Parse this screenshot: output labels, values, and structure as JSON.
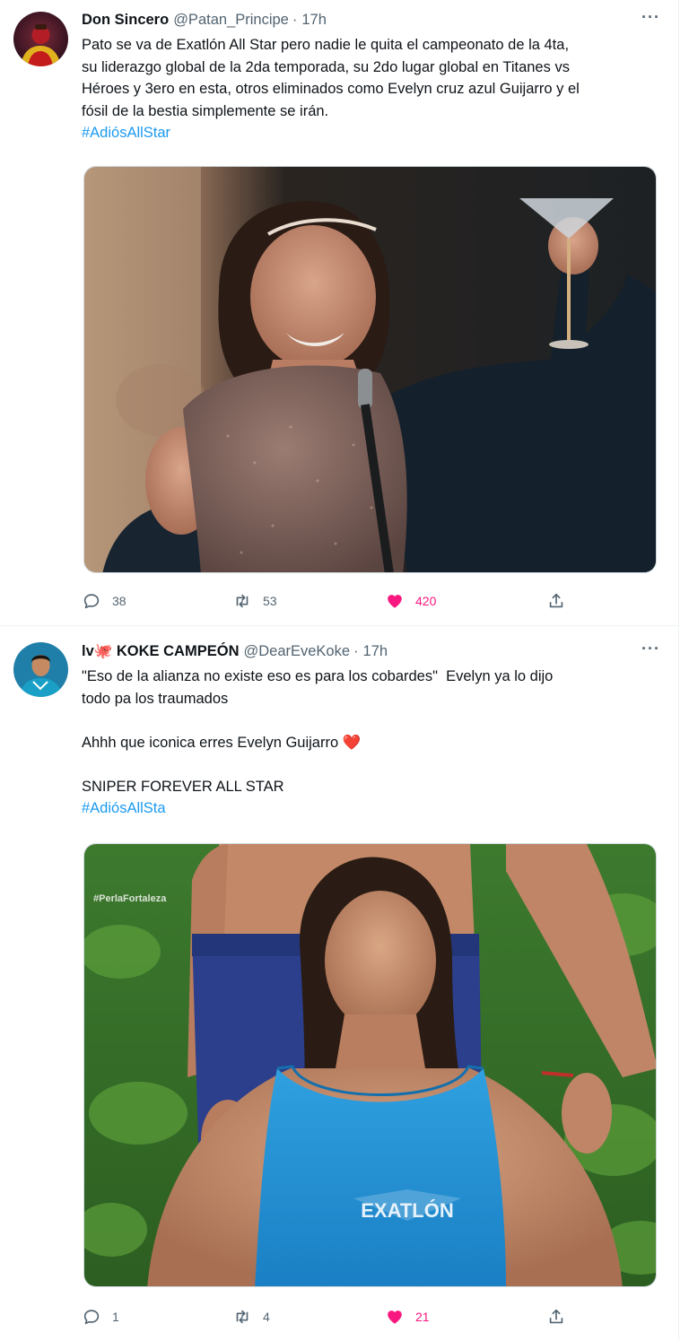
{
  "tweets": [
    {
      "author_name": "Don Sincero",
      "handle": "@Patan_Principe",
      "separator": "·",
      "time": "17h",
      "more_label": "···",
      "body_lines": "Pato se va de Exatlón All Star pero nadie le quita el campeonato de la 4ta,\nsu liderazgo global de la 2da temporada, su 2do lugar global en Titanes vs\nHéroes y 3ero en esta, otros eliminados como Evelyn cruz azul Guijarro y el\nfósil de la bestia simplemente se irán.",
      "hashtag": "#AdiósAllStar",
      "replies": "38",
      "retweets": "53",
      "likes": "420"
    },
    {
      "author_name": "lv🐙 KOKE CAMPEÓN",
      "handle": "@DearEveKoke",
      "separator": "·",
      "time": "17h",
      "more_label": "···",
      "body_lines": "\"Eso de la alianza no existe eso es para los cobardes\"  Evelyn ya lo dijo\ntodo pa los traumados\n\nAhhh que iconica erres Evelyn Guijarro ❤️\n\nSNIPER FOREVER ALL STAR",
      "hashtag": "#AdiósAllSta",
      "watermark": "#PerlaFortaleza",
      "shirt_logo": "EXATLÓN",
      "replies": "1",
      "retweets": "4",
      "likes": "21"
    }
  ],
  "colors": {
    "link": "#1d9bf0",
    "like": "#f91880",
    "muted": "#536471",
    "divider": "#eff3f4"
  },
  "icons": [
    "reply-icon",
    "retweet-icon",
    "heart-icon",
    "share-icon",
    "more-icon"
  ]
}
